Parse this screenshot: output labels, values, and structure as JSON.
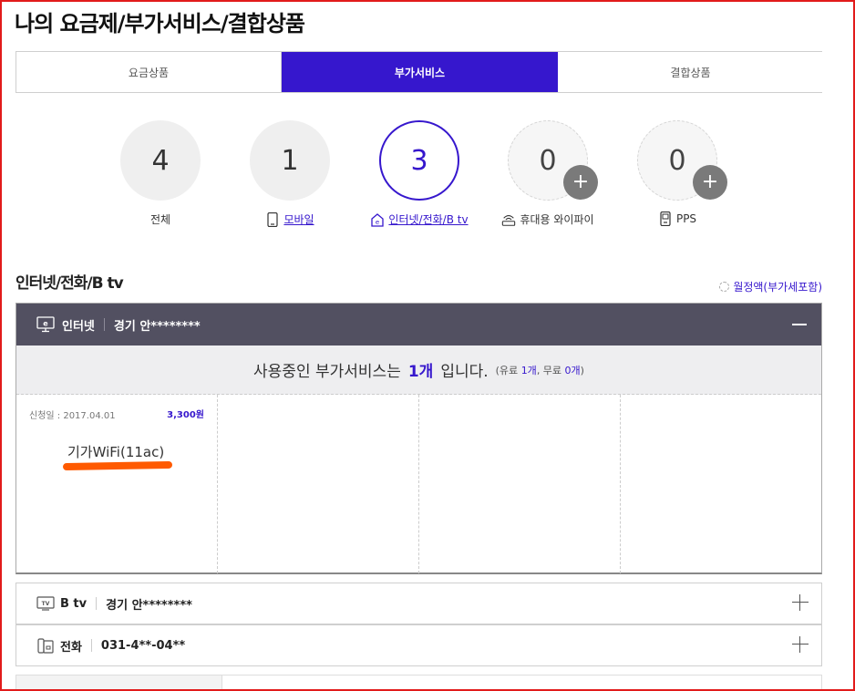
{
  "page_title": "나의 요금제/부가서비스/결합상품",
  "tabs": [
    {
      "label": "요금상품",
      "active": false
    },
    {
      "label": "부가서비스",
      "active": true
    },
    {
      "label": "결합상품",
      "active": false
    }
  ],
  "summary": [
    {
      "count": "4",
      "label": "전체",
      "icon": ""
    },
    {
      "count": "1",
      "label": "모바일",
      "icon": "mobile-icon"
    },
    {
      "count": "3",
      "label": "인터넷/전화/B tv",
      "icon": "home-e-icon"
    },
    {
      "count": "0",
      "label": "휴대용 와이파이",
      "icon": "wifi-router-icon"
    },
    {
      "count": "0",
      "label": "PPS",
      "icon": "pps-phone-icon"
    }
  ],
  "plus_badge": "+",
  "section": {
    "title": "인터넷/전화/B tv",
    "monthly_label": "월정액(부가세포함)"
  },
  "internet_panel": {
    "service": "인터넷",
    "location": "경기 안********",
    "usage": {
      "prefix": "사용중인 부가서비스는",
      "count": "1개",
      "suffix": "입니다.",
      "detail_open": "(유료",
      "paid": "1개",
      "detail_mid": ", 무료",
      "free": "0개",
      "detail_close": ")"
    },
    "cards": [
      {
        "date": "신청일 : 2017.04.01",
        "price": "3,300원",
        "name": "기가WiFi(11ac)"
      }
    ]
  },
  "rows": [
    {
      "service": "B tv",
      "detail": "경기 안********",
      "icon": "tv-icon"
    },
    {
      "service": "전화",
      "detail": "031-4**-04**",
      "icon": "phone-icon"
    }
  ],
  "colors": {
    "accent": "#3617cd",
    "panel_header": "#525061",
    "highlight_underline": "#ff5a00",
    "frame_border": "#e21b1b"
  }
}
